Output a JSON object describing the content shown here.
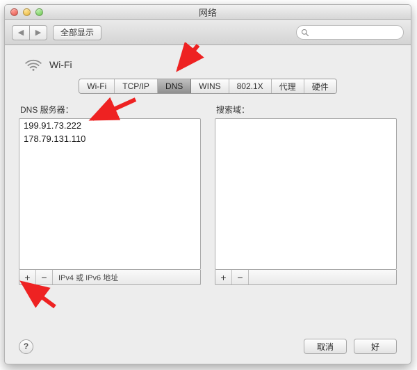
{
  "window": {
    "title": "网络"
  },
  "toolbar": {
    "show_all": "全部显示"
  },
  "connection": {
    "name": "Wi-Fi"
  },
  "tabs": [
    "Wi-Fi",
    "TCP/IP",
    "DNS",
    "WINS",
    "802.1X",
    "代理",
    "硬件"
  ],
  "tabs_active_index": 2,
  "dns": {
    "label": "DNS 服务器：",
    "servers": [
      "199.91.73.222",
      "178.79.131.110"
    ],
    "hint": "IPv4 或 IPv6 地址"
  },
  "search_domains": {
    "label": "搜索域："
  },
  "footer": {
    "cancel": "取消",
    "ok": "好"
  },
  "glyphs": {
    "plus": "+",
    "minus": "−",
    "help": "?",
    "back": "◀",
    "fwd": "▶"
  }
}
